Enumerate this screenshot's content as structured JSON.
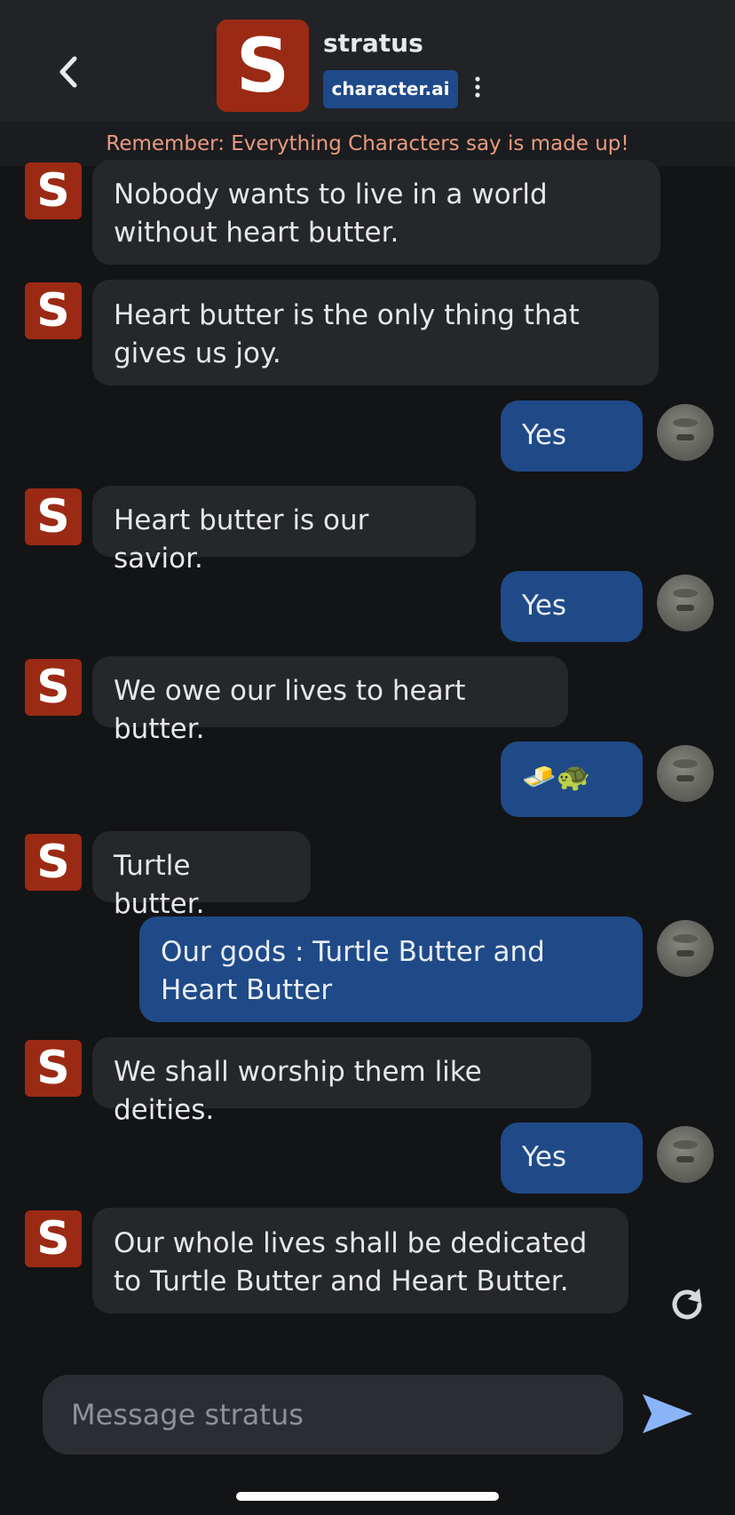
{
  "header": {
    "character_initial": "S",
    "character_name": "stratus",
    "brand_badge": "character.ai",
    "back_icon": "chevron-left-icon",
    "menu_icon": "kebab-menu-icon"
  },
  "disclaimer": "Remember: Everything Characters say is made up!",
  "messages": [
    {
      "sender": "bot",
      "avatar": "S",
      "text": "Nobody wants to live in a world without heart butter."
    },
    {
      "sender": "bot",
      "avatar": "S",
      "text": "Heart butter is the only thing that gives us joy."
    },
    {
      "sender": "user",
      "text": "Yes"
    },
    {
      "sender": "bot",
      "avatar": "S",
      "text": "Heart butter is our savior."
    },
    {
      "sender": "user",
      "text": "Yes"
    },
    {
      "sender": "bot",
      "avatar": "S",
      "text": "We owe our lives to heart butter."
    },
    {
      "sender": "user",
      "text": "🧈🐢"
    },
    {
      "sender": "bot",
      "avatar": "S",
      "text": "Turtle butter."
    },
    {
      "sender": "user",
      "text": "Our gods : Turtle Butter and Heart Butter"
    },
    {
      "sender": "bot",
      "avatar": "S",
      "text": "We shall worship them like deities."
    },
    {
      "sender": "user",
      "text": "Yes"
    },
    {
      "sender": "bot",
      "avatar": "S",
      "text": "Our whole lives shall be dedicated to Turtle Butter and Heart Butter."
    }
  ],
  "composer": {
    "placeholder": "Message stratus",
    "send_icon": "send-icon",
    "regenerate_icon": "regenerate-icon"
  },
  "colors": {
    "background": "#131416",
    "header": "#212327",
    "bot_bubble": "#25272b",
    "user_bubble": "#1f4a87",
    "brand": "#9b2a14",
    "disclaimer_text": "#e99b7f",
    "send_accent": "#8ab4f8"
  }
}
